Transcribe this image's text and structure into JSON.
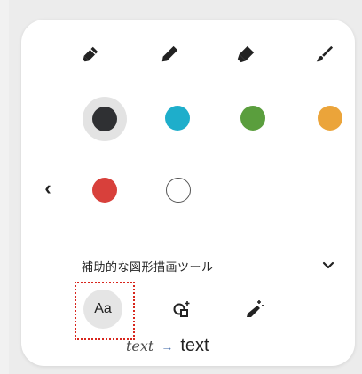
{
  "pens": [
    {
      "icon": "felt-pen-icon"
    },
    {
      "icon": "pen-icon"
    },
    {
      "icon": "highlighter-icon"
    },
    {
      "icon": "brush-icon"
    }
  ],
  "colors": {
    "row1": [
      "#2f3033",
      "#1eaecb",
      "#5a9e3d",
      "#eba43a"
    ],
    "row2": [
      "#d8403b",
      "#ffffff"
    ],
    "selected_index": 0
  },
  "back_glyph": "‹",
  "assist": {
    "label": "補助的な図形描画ツール",
    "expand_glyph": "⌄"
  },
  "tools": {
    "text_tool_label": "Aa",
    "shape_tool_icon": "shape-sparkle-icon",
    "magic_tool_icon": "magic-pen-icon"
  },
  "caption": {
    "handwritten": "text",
    "arrow": "→",
    "typed": "text"
  },
  "accent": "#d8261d"
}
